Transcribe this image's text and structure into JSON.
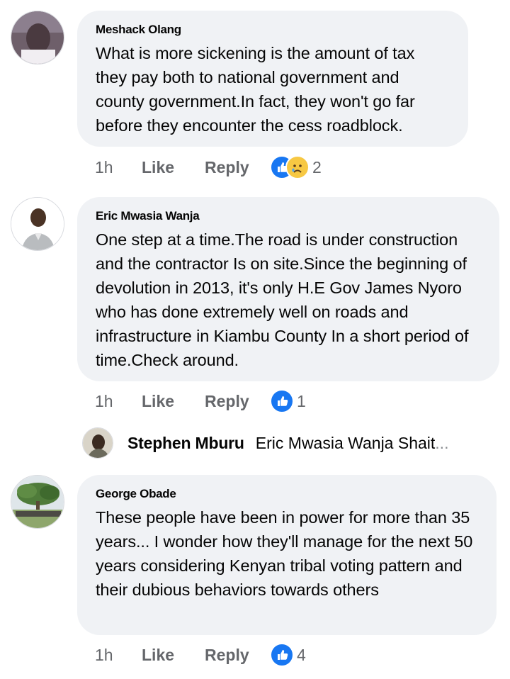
{
  "comments": [
    {
      "author": "Meshack Olang",
      "text": "What is more sickening is the amount of tax they pay both to national government and county government.In fact, they won't go far before they encounter the cess roadblock.",
      "time": "1h",
      "like_label": "Like",
      "reply_label": "Reply",
      "reaction_count": "2",
      "reactions": [
        "like-icon",
        "sad-icon"
      ]
    },
    {
      "author": "Eric Mwasia Wanja",
      "text": "One step at a time.The road is under construction and the contractor Is on site.Since the beginning of devolution in 2013, it's only H.E Gov James Nyoro who has done extremely well on roads and infrastructure in Kiambu County In a short period of time.Check around.",
      "time": "1h",
      "like_label": "Like",
      "reply_label": "Reply",
      "reaction_count": "1",
      "reactions": [
        "like-icon"
      ]
    },
    {
      "author": "George Obade",
      "text": "These people have been in power for more than 35 years... I wonder how they'll manage for the next 50 years considering Kenyan tribal voting pattern and their dubious behaviors towards others",
      "time": "1h",
      "like_label": "Like",
      "reply_label": "Reply",
      "reaction_count": "4",
      "reactions": [
        "like-icon"
      ]
    }
  ],
  "reply_preview": {
    "author": "Stephen Mburu",
    "snippet": "Eric Mwasia Wanja Shait",
    "ellipsis": "..."
  },
  "colors": {
    "bubble": "#f0f2f5",
    "meta_text": "#65676b",
    "like_blue": "#1877f2",
    "sad_yellow": "#f7c843"
  }
}
